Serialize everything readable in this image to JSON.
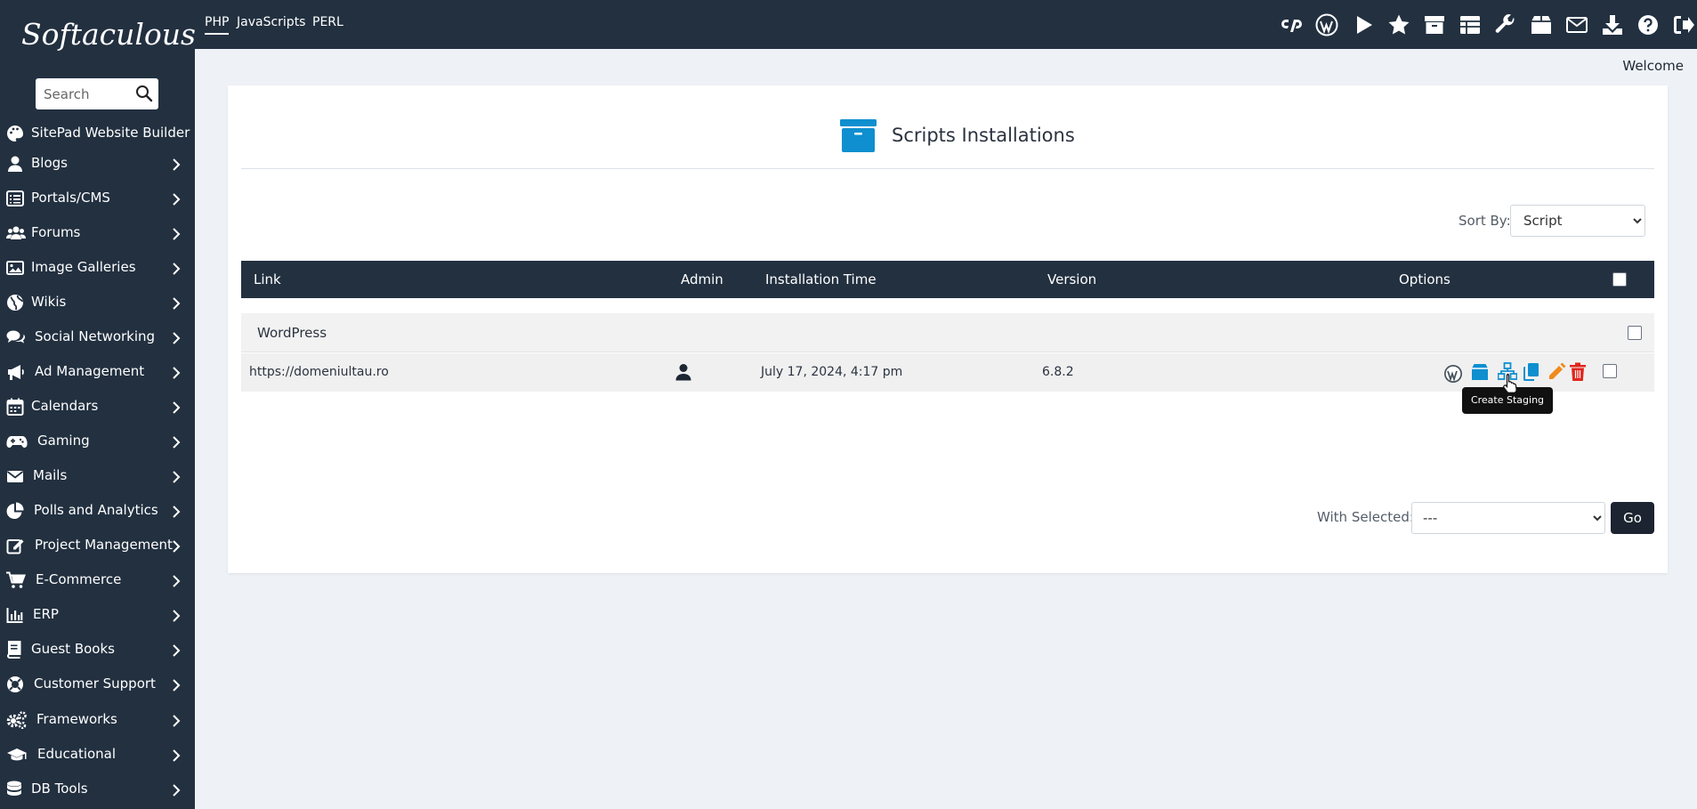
{
  "sidebar": {
    "logo": "Softaculous",
    "search_placeholder": "Search",
    "items": [
      {
        "label": "SitePad Website Builder",
        "icon": "palette-icon"
      },
      {
        "label": "Blogs",
        "icon": "user-icon"
      },
      {
        "label": "Portals/CMS",
        "icon": "list-icon"
      },
      {
        "label": "Forums",
        "icon": "users-icon"
      },
      {
        "label": "Image Galleries",
        "icon": "image-icon"
      },
      {
        "label": "Wikis",
        "icon": "globe-icon"
      },
      {
        "label": "Social Networking",
        "icon": "comments-icon"
      },
      {
        "label": "Ad Management",
        "icon": "megaphone-icon"
      },
      {
        "label": "Calendars",
        "icon": "calendar-icon"
      },
      {
        "label": "Gaming",
        "icon": "gamepad-icon"
      },
      {
        "label": "Mails",
        "icon": "envelope-icon"
      },
      {
        "label": "Polls and Analytics",
        "icon": "pie-chart-icon"
      },
      {
        "label": "Project Management",
        "icon": "edit-icon"
      },
      {
        "label": "E-Commerce",
        "icon": "cart-icon"
      },
      {
        "label": "ERP",
        "icon": "bar-chart-icon"
      },
      {
        "label": "Guest Books",
        "icon": "book-icon"
      },
      {
        "label": "Customer Support",
        "icon": "lifebuoy-icon"
      },
      {
        "label": "Frameworks",
        "icon": "cogs-icon"
      },
      {
        "label": "Educational",
        "icon": "graduation-cap-icon"
      },
      {
        "label": "DB Tools",
        "icon": "database-icon"
      }
    ]
  },
  "topbar": {
    "tabs": [
      {
        "label": "PHP",
        "active": true
      },
      {
        "label": "JavaScripts",
        "active": false
      },
      {
        "label": "PERL",
        "active": false
      }
    ],
    "icons": [
      "cpanel-icon",
      "wordpress-icon",
      "play-icon",
      "star-icon",
      "archive-icon",
      "table-icon",
      "wrench-icon",
      "box-icon",
      "envelope-icon",
      "download-icon",
      "help-icon",
      "logout-icon"
    ]
  },
  "welcome": "Welcome",
  "main": {
    "title": "Scripts Installations",
    "sort_label": "Sort By:",
    "sort_value": "Script",
    "table": {
      "columns": [
        "Link",
        "Admin",
        "Installation Time",
        "Version",
        "Options"
      ],
      "group": "WordPress",
      "rows": [
        {
          "link": "https://domeniultau.ro",
          "installation_time": "July 17, 2024, 4:17 pm",
          "version": "6.8.2"
        }
      ]
    },
    "option_icons": [
      "wordpress-icon",
      "backup-icon",
      "staging-icon",
      "clone-icon",
      "edit-icon",
      "delete-icon"
    ],
    "tooltip": "Create Staging",
    "with_selected_label": "With Selected:",
    "with_selected_value": "---",
    "go_label": "Go"
  },
  "colors": {
    "sidebar_bg": "#223040",
    "accent_blue": "#0f8fcf",
    "delete_red": "#e0261d",
    "edit_orange": "#f08a1c"
  }
}
